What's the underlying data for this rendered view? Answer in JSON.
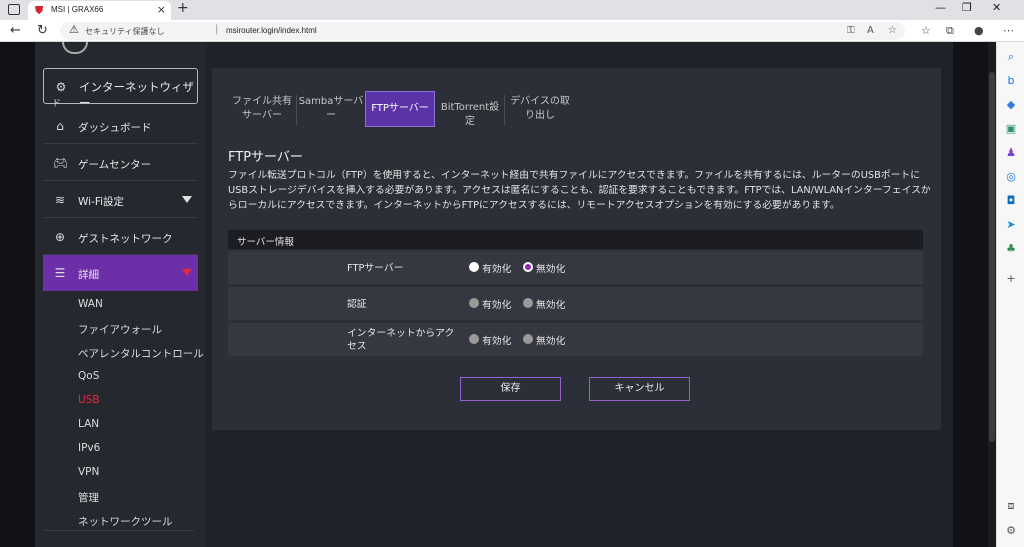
{
  "browser": {
    "tab_title": "MSI | GRAX66",
    "security_label": "セキュリティ保護なし",
    "url": "msirouter.login/index.html"
  },
  "sidebar": {
    "wizard": {
      "label": "インターネットウィザー",
      "label_overflow": "ド"
    },
    "items": [
      {
        "label": "ダッシュボード",
        "icon": "home-icon"
      },
      {
        "label": "ゲームセンター",
        "icon": "gamepad-icon"
      },
      {
        "label": "Wi-Fi設定",
        "icon": "wifi-icon"
      },
      {
        "label": "ゲストネットワーク",
        "icon": "globe-icon"
      },
      {
        "label": "詳細",
        "icon": "sliders-icon"
      }
    ],
    "sub_items": [
      "WAN",
      "ファイアウォール",
      "ペアレンタルコントロール",
      "QoS",
      "USB",
      "LAN",
      "IPv6",
      "VPN",
      "管理",
      "ネットワークツール"
    ],
    "selected_sub": "USB"
  },
  "content_tabs": [
    {
      "line1": "ファイル共有",
      "line2": "サーバー"
    },
    {
      "line1": "Sambaサーバ",
      "line2": "ー"
    },
    {
      "line1": "FTPサーバー",
      "line2": ""
    },
    {
      "line1": "BitTorrent設定",
      "line2": ""
    },
    {
      "line1": "デバイスの取",
      "line2": "り出し"
    }
  ],
  "page": {
    "title": "FTPサーバー",
    "description": "ファイル転送プロトコル（FTP）を使用すると、インターネット経由で共有ファイルにアクセスできます。ファイルを共有するには、ルーターのUSBポートにUSBストレージデバイスを挿入する必要があります。アクセスは匿名にすることも、認証を要求することもできます。FTPでは、LAN/WLANインターフェイスからローカルにアクセスできます。インターネットからFTPにアクセスするには、リモートアクセスオプションを有効にする必要があります。"
  },
  "server_info": {
    "header": "サーバー情報",
    "rows": [
      {
        "label": "FTPサーバー",
        "label2": "",
        "enable": "有効化",
        "disable": "無効化",
        "selected": "disable"
      },
      {
        "label": "認証",
        "label2": "",
        "enable": "有効化",
        "disable": "無効化",
        "selected": "none"
      },
      {
        "label": "インターネットからアク",
        "label2": "セス",
        "enable": "有効化",
        "disable": "無効化",
        "selected": "none"
      }
    ]
  },
  "buttons": {
    "save": "保存",
    "cancel": "キャンセル"
  },
  "colors": {
    "accent": "#6d2fa8",
    "selected_sub": "#e8293d",
    "panel": "#2d2f38"
  }
}
